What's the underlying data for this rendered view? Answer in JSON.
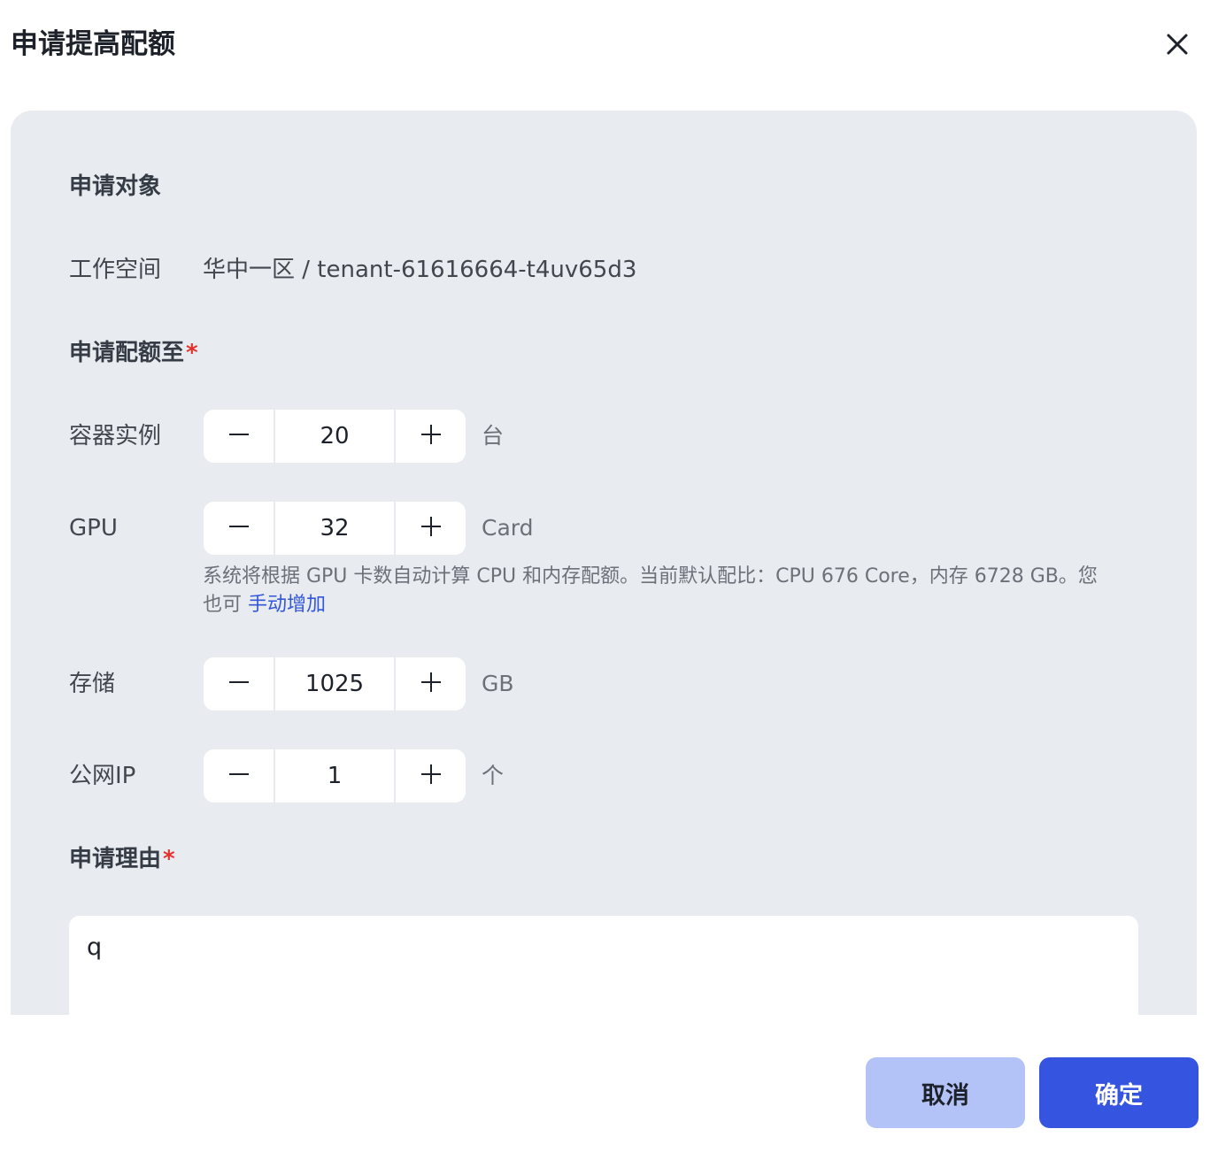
{
  "dialog": {
    "title": "申请提高配额"
  },
  "sections": {
    "target_title": "申请对象",
    "quota_title": "申请配额至",
    "reason_title": "申请理由",
    "required_mark": "*"
  },
  "workspace": {
    "label": "工作空间",
    "value": "华中一区 / tenant-61616664-t4uv65d3"
  },
  "quota": {
    "container": {
      "label": "容器实例",
      "value": "20",
      "unit": "台"
    },
    "gpu": {
      "label": "GPU",
      "value": "32",
      "unit": "Card"
    },
    "storage": {
      "label": "存储",
      "value": "1025",
      "unit": "GB"
    },
    "public_ip": {
      "label": "公网IP",
      "value": "1",
      "unit": "个"
    }
  },
  "hint": {
    "text": "系统将根据 GPU 卡数自动计算 CPU 和内存配额。当前默认配比：CPU 676 Core，内存 6728 GB。您也可 ",
    "link": "手动增加"
  },
  "reason": {
    "value": "q"
  },
  "footer": {
    "cancel_label": "取消",
    "confirm_label": "确定"
  },
  "colors": {
    "panel_bg": "#e8ebef",
    "primary": "#3555e0",
    "primary_light": "#b3c3f7",
    "required": "#e5312d",
    "link": "#3456d9"
  },
  "icons": {
    "close": "close-icon",
    "minus": "minus-icon",
    "plus": "plus-icon"
  }
}
